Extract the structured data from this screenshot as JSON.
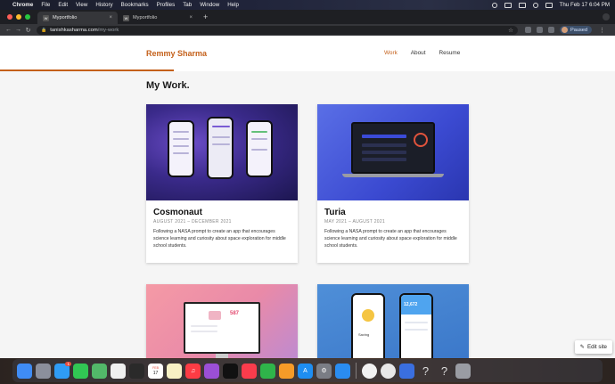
{
  "menubar": {
    "app": "Chrome",
    "items": [
      "File",
      "Edit",
      "View",
      "History",
      "Bookmarks",
      "Profiles",
      "Tab",
      "Window",
      "Help"
    ],
    "clock": "Thu Feb 17  6:04 PM"
  },
  "tabs": [
    {
      "title": "Myportfolio",
      "favicon": "W"
    },
    {
      "title": "Myportfolio",
      "favicon": "W"
    }
  ],
  "toolbar": {
    "url_host": "tanishkasharma.com",
    "url_path": "/my-work",
    "profile_status": "Paused"
  },
  "site": {
    "logo": "Remmy Sharma",
    "nav": [
      "Work",
      "About",
      "Resume"
    ],
    "active_nav": "Work",
    "section_title": "My Work."
  },
  "projects": [
    {
      "title": "Cosmonaut",
      "dates": "AUGUST 2021 – DECEMBER 2021",
      "description": "Following a NASA prompt to create an app that encourages science learning and curiosity about space exploration for middle school students."
    },
    {
      "title": "Turia",
      "dates": "MAY 2021 – AUGUST 2021",
      "description": "Following a NASA prompt to create an app that encourages science learning and curiosity about space exploration for middle school students."
    },
    {
      "title": "",
      "dates": "",
      "description": ""
    },
    {
      "title": "",
      "dates": "",
      "description": ""
    }
  ],
  "thumb_text": {
    "p3_score": "587",
    "p4_label": "Saving",
    "p4_amount": "12,672"
  },
  "edit_site": "Edit site",
  "dock": {
    "calendar_month": "FEB",
    "calendar_day": "17",
    "mail_badge": "1"
  },
  "colors": {
    "accent": "#c4601a"
  }
}
